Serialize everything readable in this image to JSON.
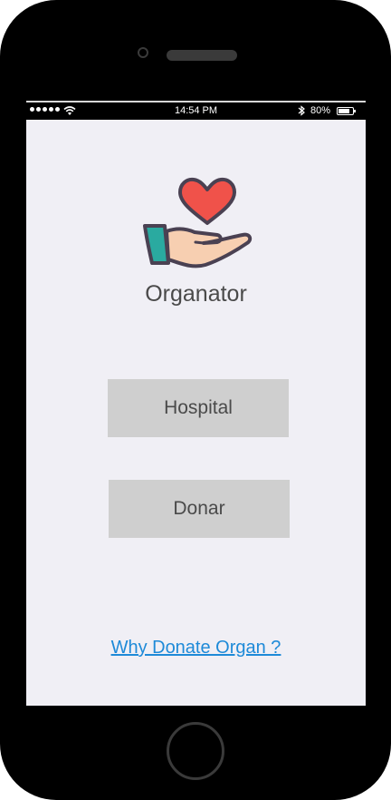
{
  "status_bar": {
    "time": "14:54 PM",
    "battery_percent": "80%",
    "battery_level": 0.8,
    "icons": [
      "signal-dots-icon",
      "wifi-icon",
      "bluetooth-icon",
      "battery-icon"
    ]
  },
  "app": {
    "logo_icon": "heart-in-hand-icon",
    "title": "Organator"
  },
  "buttons": {
    "hospital_label": "Hospital",
    "donar_label": "Donar"
  },
  "link": {
    "why_donate_label": "Why Donate Organ ?"
  },
  "colors": {
    "screen_bg": "#f0eff5",
    "button_bg": "#cfcfcf",
    "link": "#1e8ad8",
    "heart": "#f0524a",
    "cuff": "#2aaaa0",
    "hand": "#f7cfb1"
  }
}
